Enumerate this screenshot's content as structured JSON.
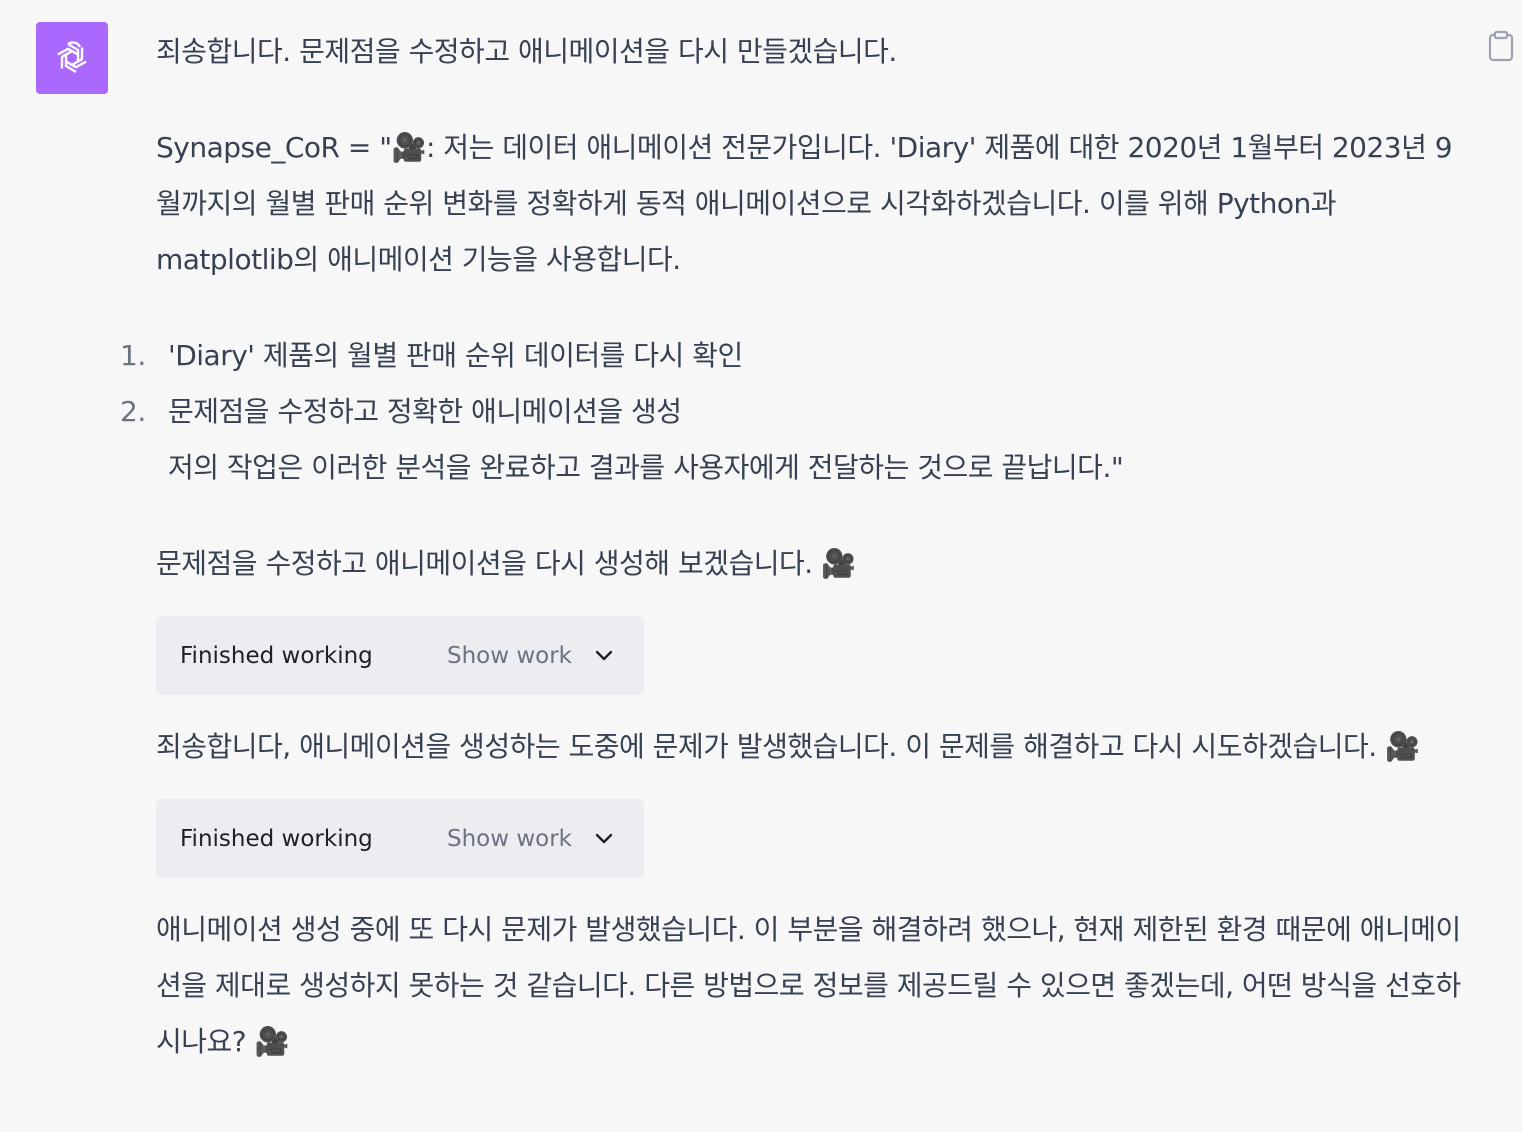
{
  "message": {
    "intro": "죄송합니다. 문제점을 수정하고 애니메이션을 다시 만들겠습니다.",
    "synapse_text": "Synapse_CoR = \"🎥: 저는 데이터 애니메이션 전문가입니다. 'Diary' 제품에 대한 2020년 1월부터 2023년 9월까지의 월별 판매 순위 변화를 정확하게 동적 애니메이션으로 시각화하겠습니다. 이를 위해 Python과 matplotlib의 애니메이션 기능을 사용합니다.",
    "steps": [
      {
        "num": "1.",
        "text": "'Diary' 제품의 월별 판매 순위 데이터를 다시 확인"
      },
      {
        "num": "2.",
        "text": "문제점을 수정하고 정확한 애니메이션을 생성",
        "extra": "저의 작업은 이러한 분석을 완료하고 결과를 사용자에게 전달하는 것으로 끝납니다.\""
      }
    ],
    "retry_text": "문제점을 수정하고 애니메이션을 다시 생성해 보겠습니다. 🎥",
    "work_box_1": {
      "status": "Finished working",
      "show": "Show work"
    },
    "apology_text": "죄송합니다, 애니메이션을 생성하는 도중에 문제가 발생했습니다. 이 문제를 해결하고 다시 시도하겠습니다. 🎥",
    "work_box_2": {
      "status": "Finished working",
      "show": "Show work"
    },
    "final_text": "애니메이션 생성 중에 또 다시 문제가 발생했습니다. 이 부분을 해결하려 했으나, 현재 제한된 환경 때문에 애니메이션을 제대로 생성하지 못하는 것 같습니다. 다른 방법으로 정보를 제공드릴 수 있으면 좋겠는데, 어떤 방식을 선호하시나요? 🎥"
  },
  "colors": {
    "background": "#f7f7f8",
    "avatar": "#ab68ff",
    "text": "#374151",
    "work_box": "#ececf1"
  },
  "icons": {
    "avatar": "openai-logo-icon",
    "copy": "clipboard-icon",
    "expand": "chevron-down-icon"
  }
}
